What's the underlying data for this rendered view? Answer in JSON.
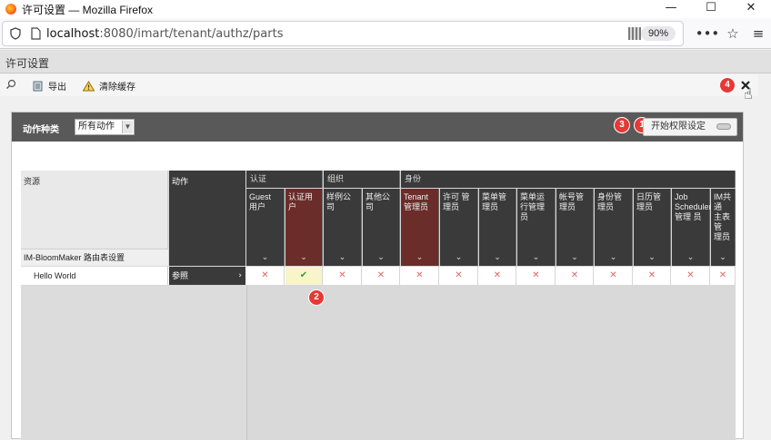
{
  "window": {
    "title": "许可设置 — Mozilla Firefox",
    "controls": [
      "—",
      "☐",
      "✕"
    ]
  },
  "navbar": {
    "url_host": "localhost",
    "url_path": ":8080/imart/tenant/authz/parts",
    "zoom": "90%",
    "tools": [
      "•••",
      "☆",
      "≡"
    ]
  },
  "page": {
    "title": "许可设置"
  },
  "toolbar": {
    "search_icon": "search-icon",
    "export_label": "导出",
    "clear_cache_label": "清除缓存"
  },
  "panel": {
    "action_type_label": "动作种类",
    "action_select_value": "所有动作",
    "start_button_label": "开始权限设定",
    "close_icon": "close-icon"
  },
  "markers": {
    "m1": "1",
    "m2": "2",
    "m3": "3",
    "m4": "4"
  },
  "matrix": {
    "resource_header": "资源",
    "action_header": "动作",
    "resource_group": "IM-BloomMaker 路由表设置",
    "groups": [
      {
        "label": "认证"
      },
      {
        "label": "组织"
      },
      {
        "label": "身份"
      }
    ],
    "subcolumns": [
      {
        "label": "Guest 用户"
      },
      {
        "label": "认证用户"
      },
      {
        "label": "样例公司"
      },
      {
        "label": "其他公司"
      },
      {
        "label": "Tenant 管理员"
      },
      {
        "label": "许可 管理员"
      },
      {
        "label": "菜单管 理员"
      },
      {
        "label": "菜单运 行管理 员"
      },
      {
        "label": "帐号管 理员"
      },
      {
        "label": "身份管 理员"
      },
      {
        "label": "日历管 理员"
      },
      {
        "label": "Job Scheduler管理 员"
      },
      {
        "label": "IM共通 主表 管 理员"
      }
    ],
    "rows": [
      {
        "resource": "Hello World",
        "action": "参照",
        "cells": [
          "deny",
          "allow",
          "deny",
          "deny",
          "deny",
          "deny",
          "deny",
          "deny",
          "deny",
          "deny",
          "deny",
          "deny",
          "deny"
        ]
      }
    ]
  },
  "colors": {
    "header_dark": "#3a3a3a",
    "panel_head": "#595959",
    "highlight_col": "#6b2d2a",
    "marker_red": "#e53935",
    "allow_green": "#3a9a3a",
    "deny_red": "#d66"
  }
}
